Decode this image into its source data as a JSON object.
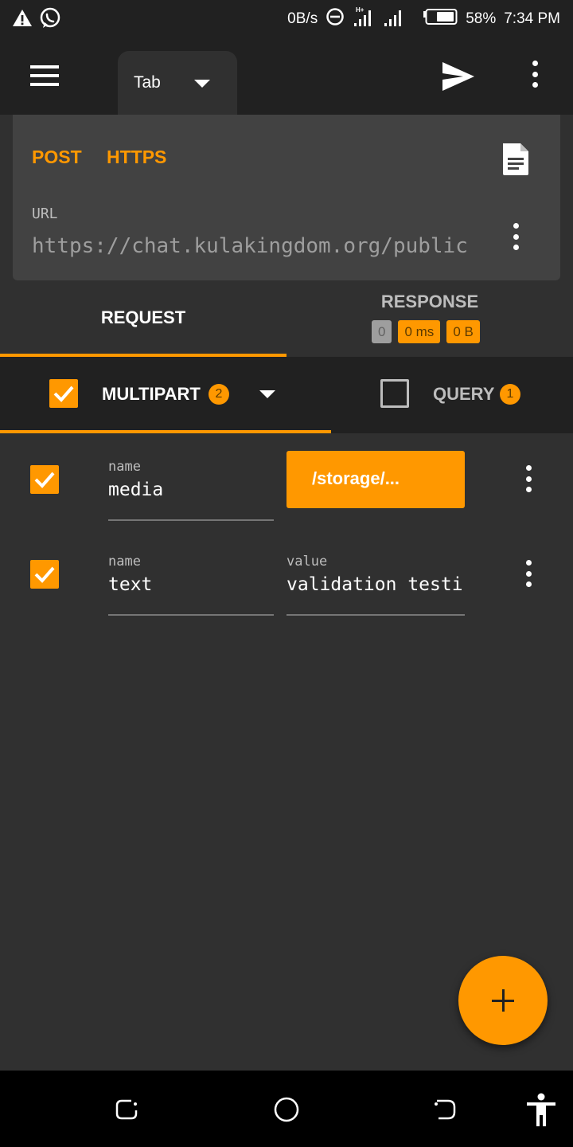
{
  "status_bar": {
    "net_speed": "0B/s",
    "network_type": "H+",
    "battery": "58%",
    "time": "7:34 PM",
    "icons": [
      "warning-icon",
      "whatsapp-icon",
      "dnd-icon",
      "signal-icon",
      "battery-icon"
    ]
  },
  "app_bar": {
    "tab_label": "Tab",
    "icons": [
      "menu-icon",
      "caret-down-icon",
      "send-icon",
      "more-vert-icon"
    ]
  },
  "request": {
    "method": "POST",
    "scheme": "HTTPS",
    "url_label": "URL",
    "url": "https://chat.kulakingdom.org/public"
  },
  "tabs": {
    "request_label": "REQUEST",
    "response_label": "RESPONSE",
    "response_badges": [
      "0",
      "0 ms",
      "0 B"
    ]
  },
  "body_tabs": {
    "multipart": {
      "label": "MULTIPART",
      "count": "2",
      "enabled": true
    },
    "query": {
      "label": "QUERY",
      "count": "1",
      "enabled": false
    }
  },
  "params": [
    {
      "enabled": true,
      "name_caption": "name",
      "name": "media",
      "type": "file",
      "file_label": "/storage/..."
    },
    {
      "enabled": true,
      "name_caption": "name",
      "name": "text",
      "type": "text",
      "value_caption": "value",
      "value": "validation testi"
    }
  ],
  "colors": {
    "accent": "#ff9800",
    "background": "#303030",
    "bar": "#212121",
    "card": "#424242"
  }
}
